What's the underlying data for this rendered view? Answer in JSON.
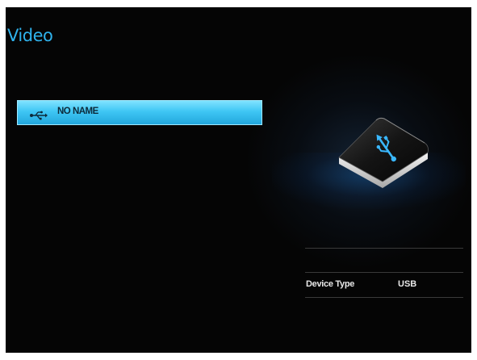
{
  "header": {
    "title": "Video"
  },
  "devices": [
    {
      "icon": "usb-icon",
      "label": "NO NAME",
      "selected": true
    }
  ],
  "device_preview": {
    "icon": "usb-drive-icon"
  },
  "info": {
    "rows": [
      {
        "key": "Device Type",
        "value": "USB"
      }
    ]
  },
  "colors": {
    "accent": "#2fb2ec",
    "selection": "#3fc6f4",
    "background": "#050505"
  }
}
